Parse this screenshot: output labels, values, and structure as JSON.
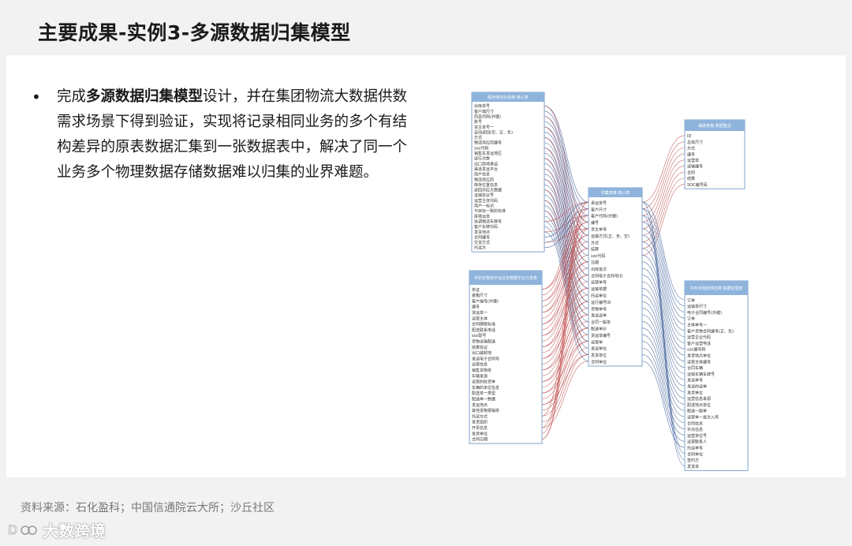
{
  "title": "主要成果-实例3-多源数据归集模型",
  "bullet": {
    "prefix": "完成",
    "bold": "多源数据归集模型",
    "rest": "设计，并在集团物流大数据供数需求场景下得到验证，实现将记录相同业务的多个有结构差异的原表数据汇集到一张数据表中，解决了同一个业务多个物理数据存储数据难以归集的业界难题。"
  },
  "source": "资料来源：石化盈科；中国信通院云大所；沙丘社区",
  "watermark": {
    "text": "大数跨境"
  },
  "diagram": {
    "tables": [
      {
        "name": "table-top-left",
        "title": "股份物流云系统 核心表",
        "rows": [
          "出库单号",
          "客户端尺寸",
          "商品代码(外键)",
          "账号",
          "货主单号一",
          "自动返回(空、正、负)",
          "方式",
          "物流供应商编号",
          "soc代码",
          "销售车发运地区",
          "运行次数",
          "出口用地承运",
          "渠道发运平台",
          "用户信息",
          "物流供应商",
          "库存位置信息",
          "返回对应大数据",
          "运输协议号",
          "运营主体代码",
          "用户一标识",
          "与目标一致的标准",
          "拼搭运单",
          "协调物流车牌号",
          "客户车牌代码",
          "发货地点",
          "合同编号",
          "交货方式",
          "托运方"
        ]
      },
      {
        "name": "table-bottom-left",
        "title": "中石化物流平台业务数据平台订单表",
        "rows": [
          "单证",
          "装箱尺寸",
          "客户端号(外键)",
          "编号",
          "货运单一",
          "运营主体",
          "合同期限标准",
          "配送联系电话",
          "soc配号",
          "货物运输配送",
          "结算协议",
          "出口装卸地",
          "发运电子合同号",
          "运营信息",
          "销售货物单",
          "车辆来源",
          "运营的收货单",
          "车辆的单位信息",
          "配送单一类型",
          "配送单一数据",
          "发运地点",
          "其他货物报销单",
          "托运方式",
          "发货组织",
          "开票信息",
          "发货单位",
          "合同日期"
        ]
      },
      {
        "name": "table-center",
        "title": "归集表格 核心表",
        "rows": [
          "承运单号",
          "客户尺寸",
          "客户代码(外键)",
          "编号",
          "货主单号",
          "运输方式(正、负、空)",
          "方式",
          "结算",
          "soc代码",
          "日期",
          "出库批次",
          "合同电子合同号ID",
          "运营单号",
          "运输单据",
          "托运单位",
          "运行编号ID",
          "货物单号",
          "发运运单",
          "合同一般单",
          "配送单价",
          "货运单编号",
          "运营单",
          "发运单位",
          "发货单位",
          "合同单位"
        ]
      },
      {
        "name": "table-top-right",
        "title": "辅助表格 数据整合",
        "rows": [
          "ID",
          "总体尺寸",
          "方式",
          "编号",
          "运营单",
          "运输编号",
          "合同",
          "结算",
          "SOC编号码"
        ]
      },
      {
        "name": "table-bottom-right",
        "title": "中石化物流供应链 数据处理表",
        "rows": [
          "订单",
          "运输单尺寸",
          "电子合同编号(外键)",
          "订单",
          "主体单号一",
          "客户货物合同编号(正、负)",
          "运营企业代码",
          "客户运营电话",
          "soc编号码",
          "发货地点单位",
          "运营主体编号",
          "合同车辆",
          "运输车辆车牌号",
          "发运单号",
          "发运的运单",
          "发货单位",
          "运营信息来源",
          "配送地点单位",
          "配送一般单",
          "运营单一批次入库",
          "合同信息",
          "补充信息",
          "运营单位号",
          "运营联系人",
          "托运单号",
          "合同单位",
          "签约方",
          "发货单"
        ]
      }
    ]
  }
}
